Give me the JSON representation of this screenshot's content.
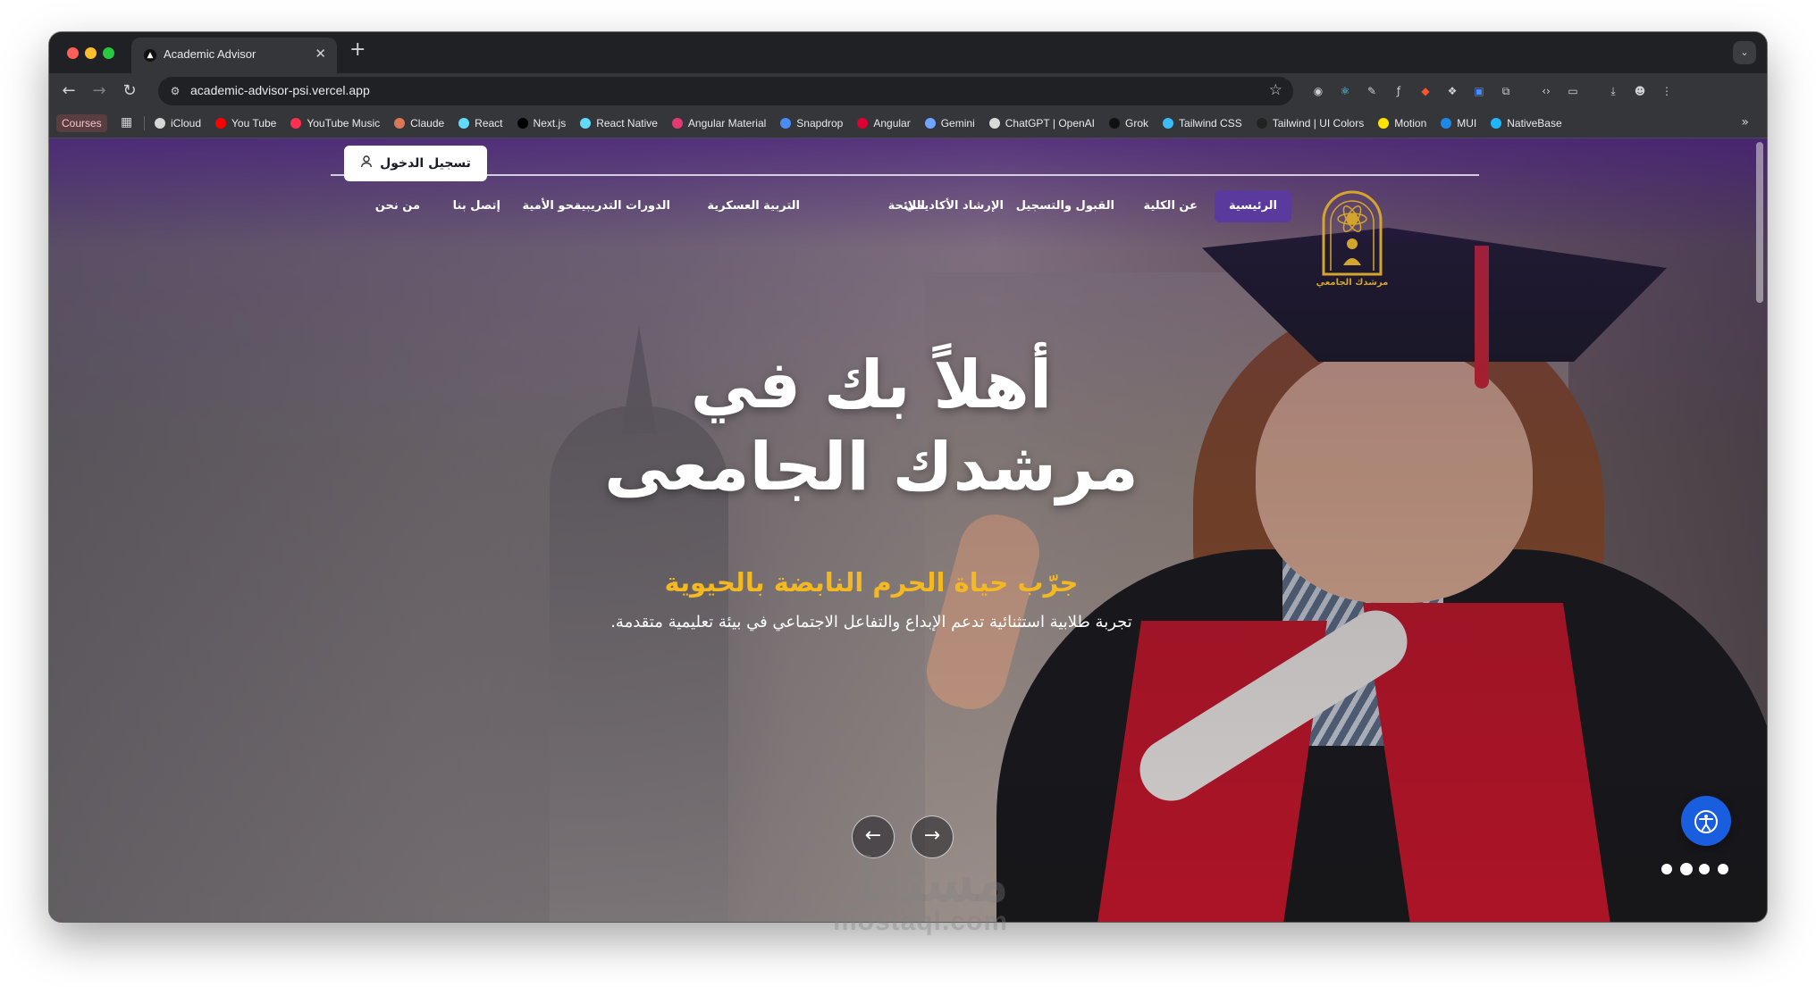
{
  "browser": {
    "tab_title": "Academic Advisor",
    "url": "academic-advisor-psi.vercel.app",
    "bookmarks_first": "Courses",
    "bookmarks": [
      {
        "label": "iCloud",
        "color": "#d6d6d6"
      },
      {
        "label": "You Tube",
        "color": "#ff0000"
      },
      {
        "label": "YouTube Music",
        "color": "#ff2f4f"
      },
      {
        "label": "Claude",
        "color": "#d97757"
      },
      {
        "label": "React",
        "color": "#61dafb"
      },
      {
        "label": "Next.js",
        "color": "#000000"
      },
      {
        "label": "React Native",
        "color": "#61dafb"
      },
      {
        "label": "Angular Material",
        "color": "#e23a72"
      },
      {
        "label": "Snapdrop",
        "color": "#4a8bf5"
      },
      {
        "label": "Angular",
        "color": "#dd0031"
      },
      {
        "label": "Gemini",
        "color": "#6fa4ff"
      },
      {
        "label": "ChatGPT | OpenAI",
        "color": "#d9d9d9"
      },
      {
        "label": "Grok",
        "color": "#111111"
      },
      {
        "label": "Tailwind CSS",
        "color": "#38bdf8"
      },
      {
        "label": "Tailwind | UI Colors",
        "color": "#222222"
      },
      {
        "label": "Motion",
        "color": "#ffe300"
      },
      {
        "label": "MUI",
        "color": "#1e88e5"
      },
      {
        "label": "NativeBase",
        "color": "#1fb6ff"
      }
    ]
  },
  "site": {
    "login_label": "تسجيل الدخول",
    "logo_text": "مرشدك الجامعي",
    "nav": [
      {
        "label": "الرئيسية",
        "active": true
      },
      {
        "label": "عن الكلية"
      },
      {
        "label": "القبول والتسجيل"
      },
      {
        "label": "الإرشاد الأكاديمي"
      },
      {
        "label": "اللائحة"
      },
      {
        "label": "التربية العسكرية"
      },
      {
        "label": "الدورات التدريبية"
      },
      {
        "label": "محو الأمية"
      },
      {
        "label": "إتصل بنا"
      },
      {
        "label": "من نحن"
      }
    ],
    "hero": {
      "title": "أهلاً بك في مرشدك الجامعى",
      "subtitle": "جرّب حياة الحرم النابضة بالحيوية",
      "description": "تجربة طلابية استثنائية تدعم الإبداع والتفاعل الاجتماعي في بيئة تعليمية متقدمة."
    },
    "slider_dots": 4,
    "active_dot": 1
  },
  "watermark": {
    "arabic": "مستقل",
    "latin": "mostaql.com"
  },
  "colors": {
    "accent_purple": "#5a3a9c",
    "subtitle_gold": "#f4b820",
    "fab_blue": "#1a5ee0"
  }
}
